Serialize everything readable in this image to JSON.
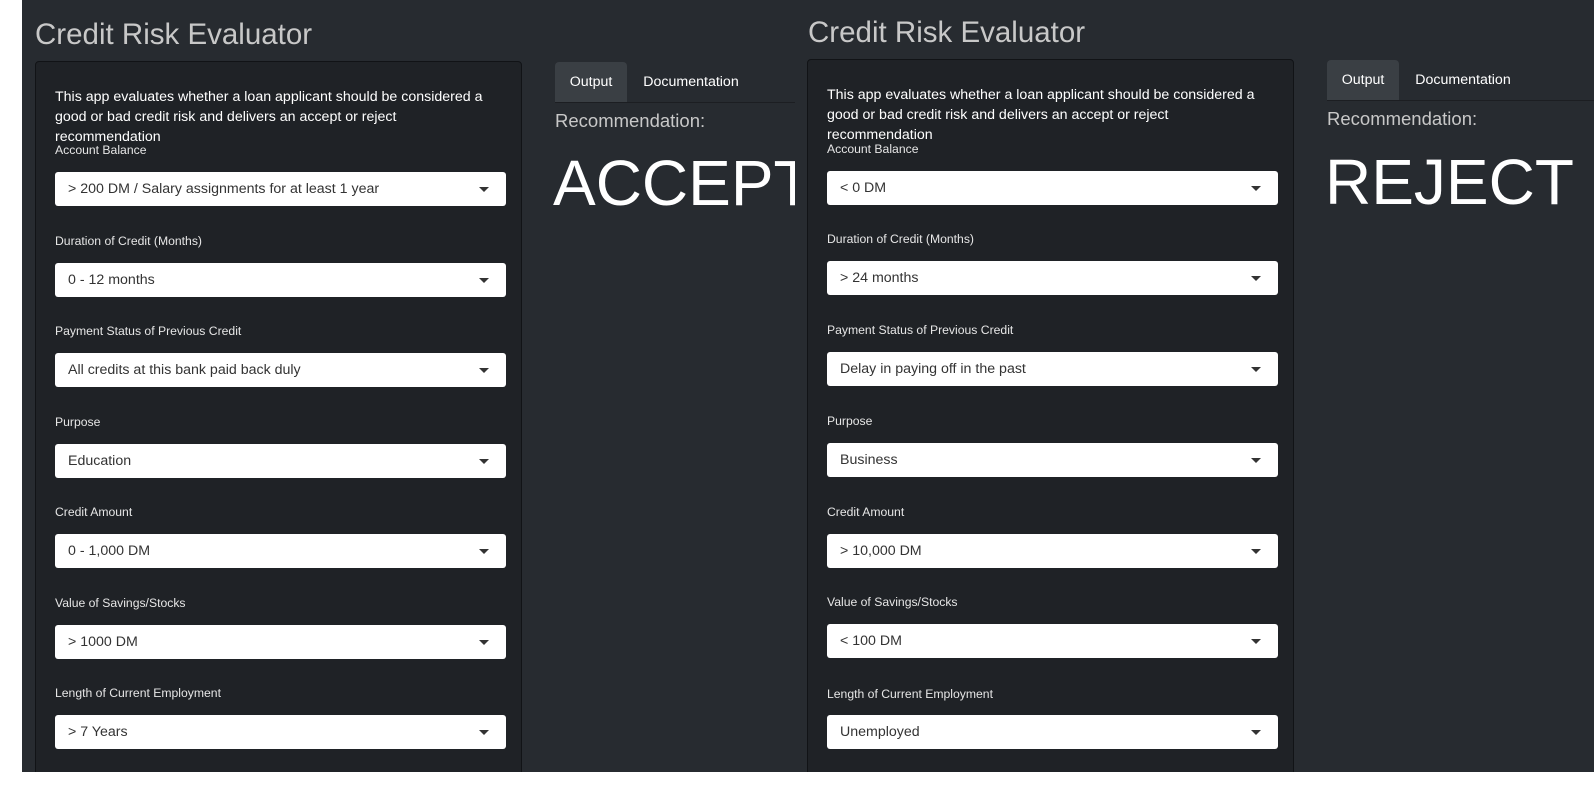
{
  "apps": [
    {
      "title": "Credit Risk Evaluator",
      "description": "This app evaluates whether a loan applicant should be considered a good or bad credit risk and delivers an accept or reject recommendation",
      "fields": [
        {
          "label": "Account Balance",
          "value": "> 200 DM / Salary assignments for at least 1 year"
        },
        {
          "label": "Duration of Credit (Months)",
          "value": "0 - 12 months"
        },
        {
          "label": "Payment Status of Previous Credit",
          "value": "All credits at this bank paid back duly"
        },
        {
          "label": "Purpose",
          "value": "Education"
        },
        {
          "label": "Credit Amount",
          "value": "0 - 1,000 DM"
        },
        {
          "label": "Value of Savings/Stocks",
          "value": "> 1000 DM"
        },
        {
          "label": "Length of Current Employment",
          "value": "> 7 Years"
        }
      ],
      "tabs": {
        "output": "Output",
        "documentation": "Documentation"
      },
      "recommendation_label": "Recommendation:",
      "recommendation": "ACCEPT"
    },
    {
      "title": "Credit Risk Evaluator",
      "description": "This app evaluates whether a loan applicant should be considered a good or bad credit risk and delivers an accept or reject recommendation",
      "fields": [
        {
          "label": "Account Balance",
          "value": "< 0 DM"
        },
        {
          "label": "Duration of Credit (Months)",
          "value": "> 24 months"
        },
        {
          "label": "Payment Status of Previous Credit",
          "value": "Delay in paying off in the past"
        },
        {
          "label": "Purpose",
          "value": "Business"
        },
        {
          "label": "Credit Amount",
          "value": "> 10,000 DM"
        },
        {
          "label": "Value of Savings/Stocks",
          "value": "< 100 DM"
        },
        {
          "label": "Length of Current Employment",
          "value": "Unemployed"
        }
      ],
      "tabs": {
        "output": "Output",
        "documentation": "Documentation"
      },
      "recommendation_label": "Recommendation:",
      "recommendation": "REJECT"
    }
  ],
  "colors": {
    "page_background": "#272b30",
    "panel_background": "#1f2226",
    "active_tab": "#3a3f44",
    "title_text": "#c8c8c8",
    "select_background": "#ffffff"
  },
  "icons": {
    "select_caret": "caret-down-icon"
  }
}
